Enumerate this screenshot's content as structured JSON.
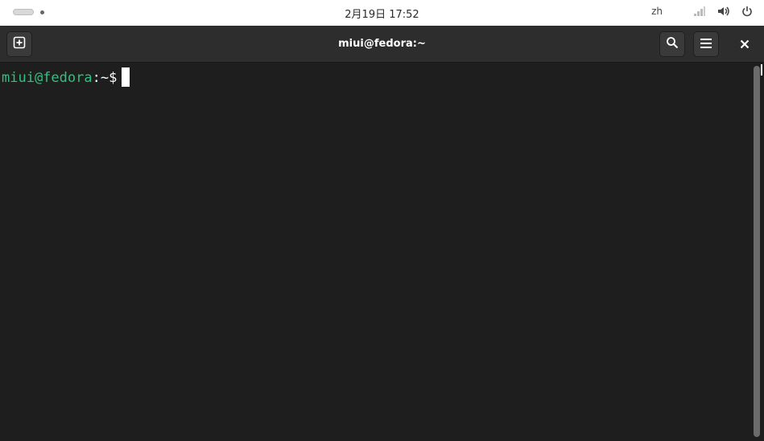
{
  "topbar": {
    "clock": "2月19日 17:52",
    "input_method": "zh",
    "icons": [
      "activities-indicator",
      "network-icon",
      "volume-icon",
      "power-icon"
    ]
  },
  "window": {
    "title": "miui@fedora:~",
    "buttons": {
      "new_tab_icon": "new-tab-icon",
      "search_icon": "search-icon",
      "menu_icon": "hamburger-menu-icon",
      "close_icon": "close-icon"
    }
  },
  "terminal": {
    "user_host": "miui@fedora",
    "separator_path": ":~",
    "prompt_symbol": "$"
  },
  "colors": {
    "terminal_bg": "#1e1e1e",
    "prompt_green": "#2ec27e",
    "headerbar_bg": "#2d2d2d",
    "topbar_bg": "#ffffff"
  }
}
